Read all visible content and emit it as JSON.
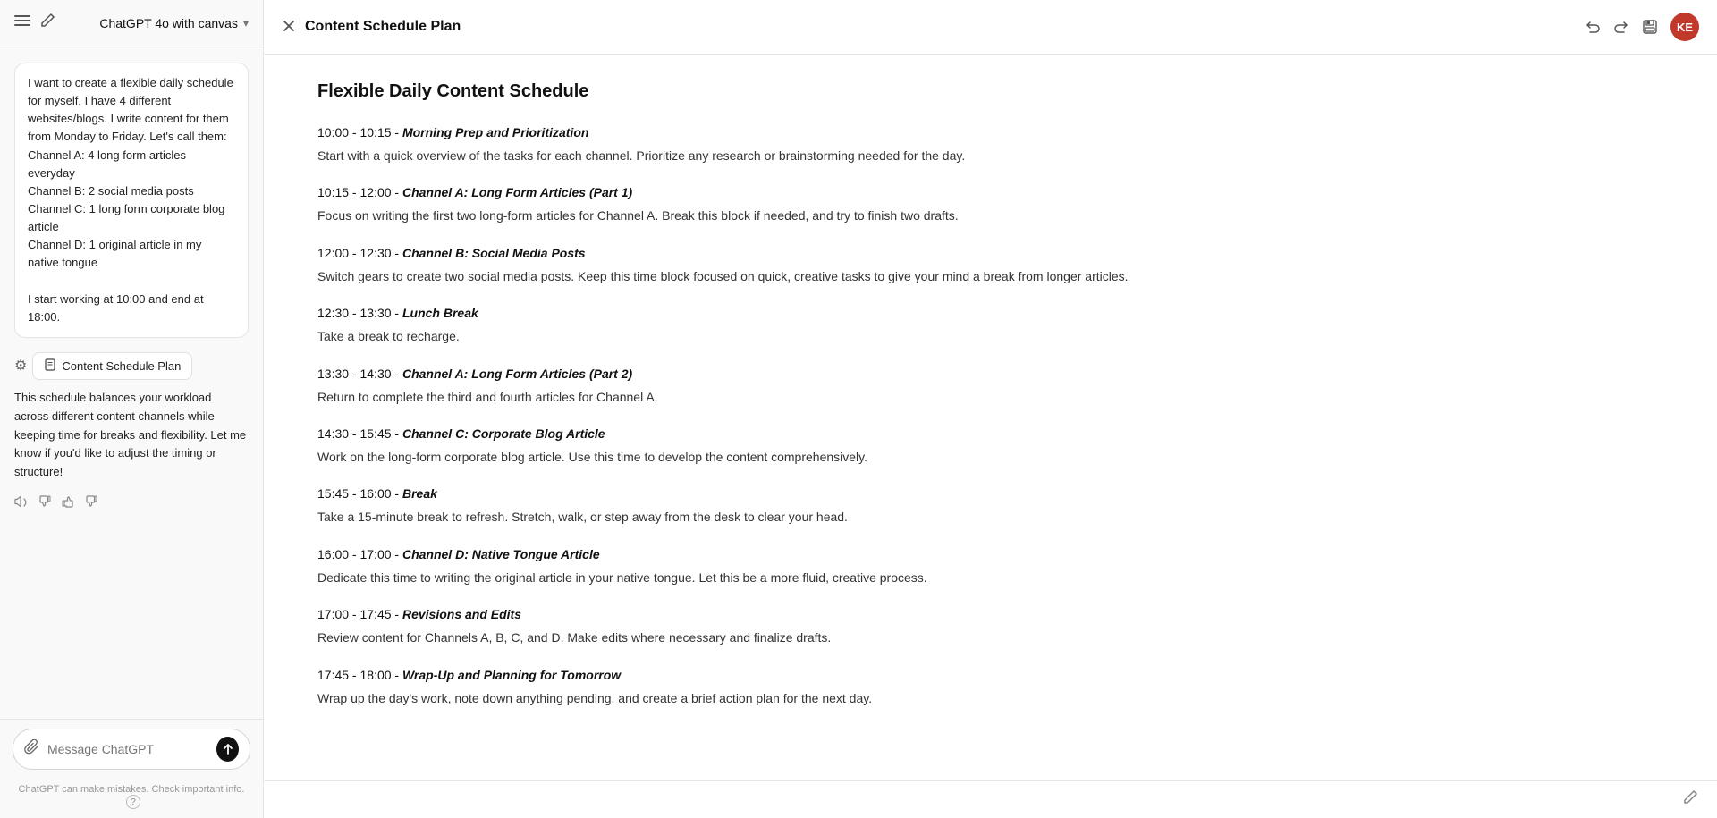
{
  "sidebar": {
    "header": {
      "app_title": "ChatGPT 4o with canvas",
      "chevron": "▾"
    },
    "user_message": "I want to create a flexible daily schedule for myself. I have 4 different websites/blogs. I write content for them from Monday to Friday. Let's call them:\nChannel A: 4 long form articles everyday\nChannel B: 2 social media posts\nChannel C: 1 long form corporate blog article\nChannel D: 1 original article in my native tongue\n\nI start working at 10:00 and end at 18:00.",
    "settings_icon": "⚙",
    "canvas_tab_label": "Content Schedule Plan",
    "canvas_tab_icon": "📄",
    "assistant_text": "This schedule balances your workload across different content channels while keeping time for breaks and flexibility. Let me know if you'd like to adjust the timing or structure!",
    "feedback": {
      "speaker": "🔊",
      "thumbsdown_alt": "👎",
      "thumbsup": "👍",
      "thumbsdown": "👎"
    },
    "input": {
      "placeholder": "Message ChatGPT",
      "attach_icon": "📎",
      "send_icon": "↑"
    },
    "disclaimer": "ChatGPT can make mistakes. Check important info.",
    "help": "?"
  },
  "canvas": {
    "header": {
      "close_icon": "✕",
      "title": "Content Schedule Plan",
      "undo_icon": "↩",
      "redo_icon": "↪",
      "save_icon": "💾"
    },
    "schedule_title": "Flexible Daily Content Schedule",
    "blocks": [
      {
        "time": "10:00 - 10:15",
        "separator": " - ",
        "title": "Morning Prep and Prioritization",
        "description": "Start with a quick overview of the tasks for each channel. Prioritize any research or brainstorming needed for the day."
      },
      {
        "time": "10:15 - 12:00",
        "separator": " - ",
        "title": "Channel A: Long Form Articles (Part 1)",
        "description": "Focus on writing the first two long-form articles for Channel A. Break this block if needed, and try to finish two drafts."
      },
      {
        "time": "12:00 - 12:30",
        "separator": " - ",
        "title": "Channel B: Social Media Posts",
        "description": "Switch gears to create two social media posts. Keep this time block focused on quick, creative tasks to give your mind a break from longer articles."
      },
      {
        "time": "12:30 - 13:30",
        "separator": " - ",
        "title": "Lunch Break",
        "description": "Take a break to recharge."
      },
      {
        "time": "13:30 - 14:30",
        "separator": " - ",
        "title": "Channel A: Long Form Articles (Part 2)",
        "description": "Return to complete the third and fourth articles for Channel A."
      },
      {
        "time": "14:30 - 15:45",
        "separator": " - ",
        "title": "Channel C: Corporate Blog Article",
        "description": "Work on the long-form corporate blog article. Use this time to develop the content comprehensively."
      },
      {
        "time": "15:45 - 16:00",
        "separator": " - ",
        "title": "Break",
        "description": "Take a 15-minute break to refresh. Stretch, walk, or step away from the desk to clear your head."
      },
      {
        "time": "16:00 - 17:00",
        "separator": " - ",
        "title": "Channel D: Native Tongue Article",
        "description": "Dedicate this time to writing the original article in your native tongue. Let this be a more fluid, creative process."
      },
      {
        "time": "17:00 - 17:45",
        "separator": " - ",
        "title": "Revisions and Edits",
        "description": "Review content for Channels A, B, C, and D. Make edits where necessary and finalize drafts."
      },
      {
        "time": "17:45 - 18:00",
        "separator": " - ",
        "title": "Wrap-Up and Planning for Tomorrow",
        "description": "Wrap up the day's work, note down anything pending, and create a brief action plan for the next day."
      }
    ],
    "bottom_icon": "✎"
  }
}
